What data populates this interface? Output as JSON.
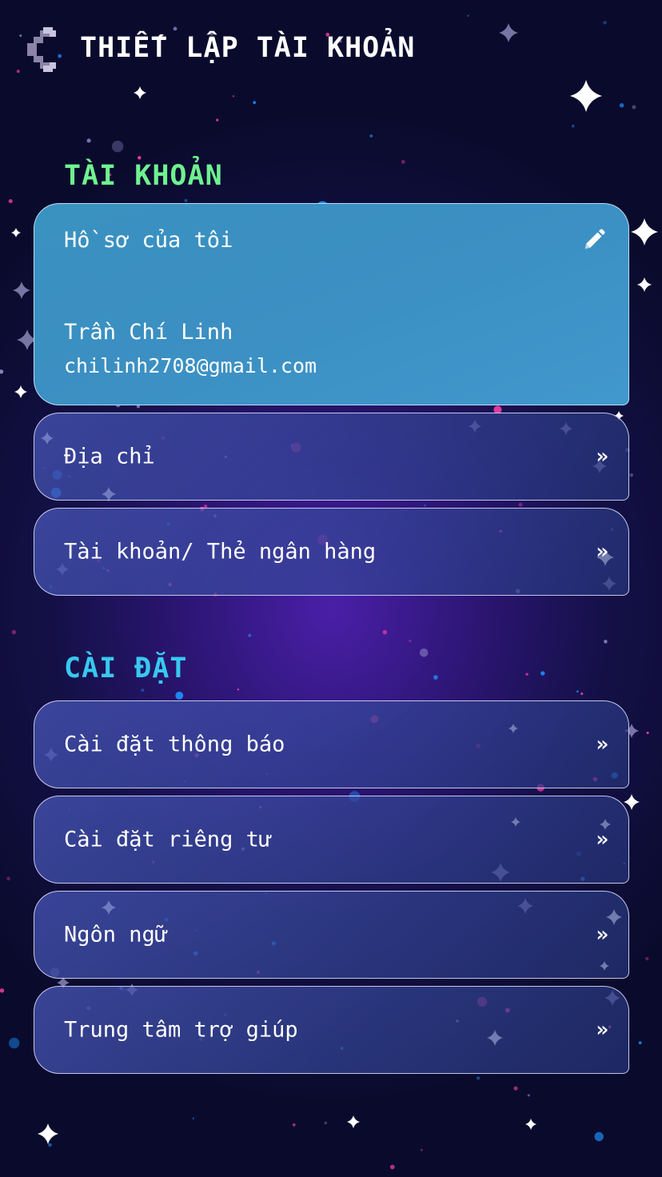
{
  "header": {
    "title": "THIẾT LẬP TÀI KHOẢN",
    "back_icon": "chevron-left-icon"
  },
  "account_section": {
    "title": "TÀI KHOẢN",
    "title_color": "#6ff28f",
    "profile": {
      "label": "Hồ sơ của tôi",
      "edit_icon": "pencil-icon",
      "name": "Trần Chí Linh",
      "email": "chilinh2708@gmail.com"
    },
    "items": [
      {
        "label": "Địa chỉ",
        "arrow": "»"
      },
      {
        "label": "Tài khoản/ Thẻ ngân hàng",
        "arrow": "»"
      }
    ]
  },
  "settings_section": {
    "title": "CÀI ĐẶT",
    "title_color": "#38c8f0",
    "items": [
      {
        "label": "Cài đặt thông báo",
        "arrow": "»"
      },
      {
        "label": "Cài đặt riêng tư",
        "arrow": "»"
      },
      {
        "label": "Ngôn ngữ",
        "arrow": "»"
      },
      {
        "label": "Trung tâm trợ giúp",
        "arrow": "»"
      }
    ]
  },
  "theme": {
    "card_border": "#e1e1ff",
    "profile_card_bg": "#3b8fc2",
    "background_top": "#0a0b2c",
    "background_center": "#4a1fa8",
    "star_pink": "#ff3fa8",
    "star_blue": "#1e90ff"
  }
}
